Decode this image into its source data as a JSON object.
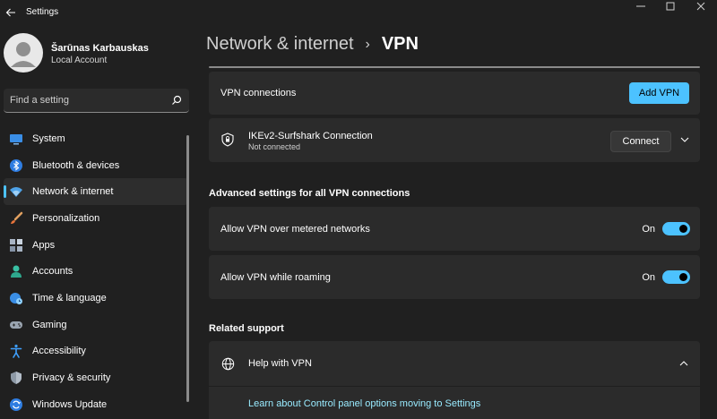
{
  "window": {
    "title": "Settings"
  },
  "profile": {
    "name": "Šarūnas Karbauskas",
    "account_type": "Local Account"
  },
  "search": {
    "placeholder": "Find a setting"
  },
  "sidebar": {
    "selected": "Network & internet",
    "items": [
      {
        "label": "System",
        "icon": "monitor-icon"
      },
      {
        "label": "Bluetooth & devices",
        "icon": "bluetooth-icon"
      },
      {
        "label": "Network & internet",
        "icon": "wifi-icon"
      },
      {
        "label": "Personalization",
        "icon": "paintbrush-icon"
      },
      {
        "label": "Apps",
        "icon": "apps-icon"
      },
      {
        "label": "Accounts",
        "icon": "person-icon"
      },
      {
        "label": "Time & language",
        "icon": "globe-clock-icon"
      },
      {
        "label": "Gaming",
        "icon": "gamepad-icon"
      },
      {
        "label": "Accessibility",
        "icon": "accessibility-icon"
      },
      {
        "label": "Privacy & security",
        "icon": "shield-icon"
      },
      {
        "label": "Windows Update",
        "icon": "update-icon"
      }
    ]
  },
  "breadcrumb": {
    "parent": "Network & internet",
    "separator": "›",
    "current": "VPN"
  },
  "vpn": {
    "connections_label": "VPN connections",
    "add_button": "Add VPN",
    "connection": {
      "name": "IKEv2-Surfshark Connection",
      "status": "Not connected",
      "connect_button": "Connect"
    }
  },
  "advanced": {
    "heading": "Advanced settings for all VPN connections",
    "settings": [
      {
        "label": "Allow VPN over metered networks",
        "state": "On",
        "enabled": true
      },
      {
        "label": "Allow VPN while roaming",
        "state": "On",
        "enabled": true
      }
    ]
  },
  "support": {
    "heading": "Related support",
    "help_title": "Help with VPN",
    "link": "Learn about Control panel options moving to Settings"
  },
  "colors": {
    "accent": "#4cc2ff",
    "background": "#202020",
    "card": "#2b2b2b",
    "link": "#99ebff"
  }
}
